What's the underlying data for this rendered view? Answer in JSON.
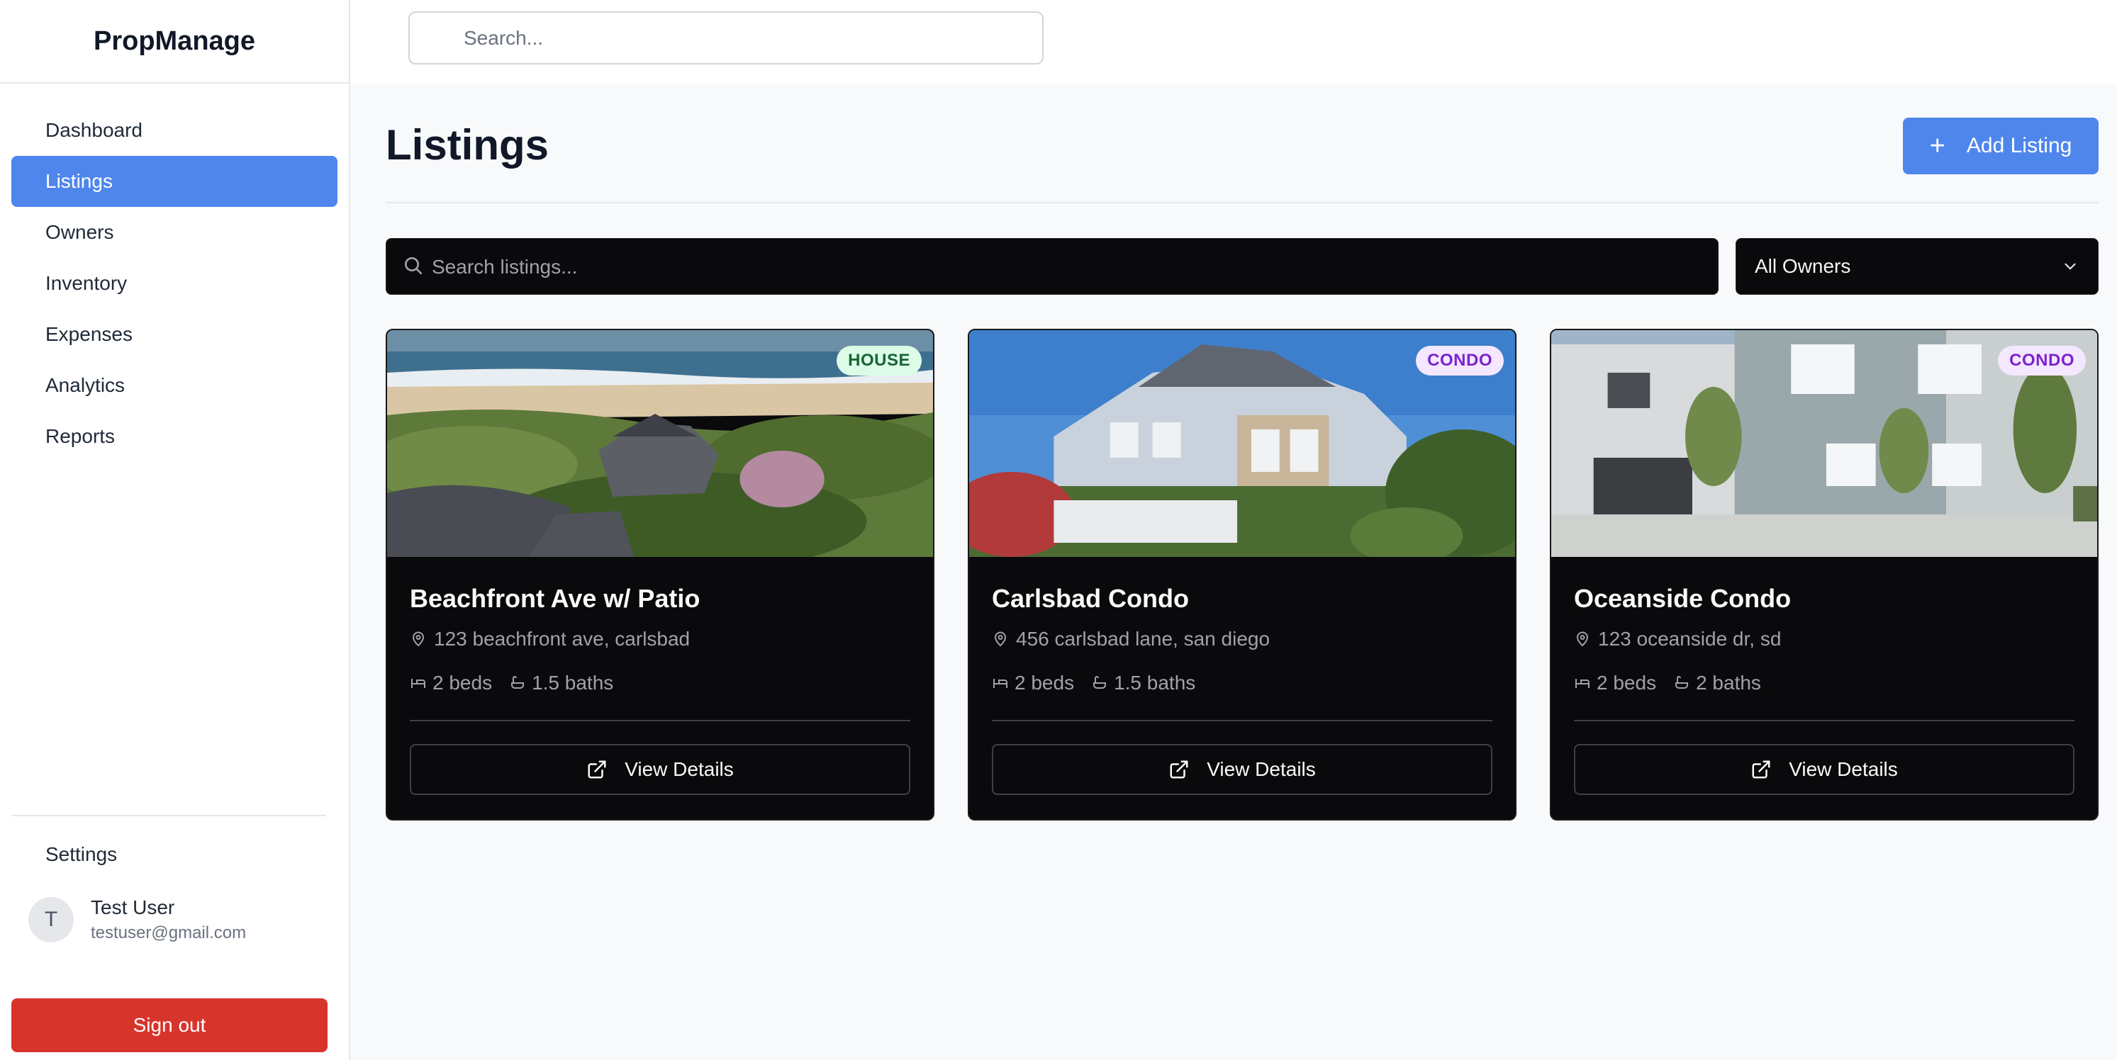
{
  "app": {
    "brand": "PropManage"
  },
  "sidebar": {
    "items": [
      {
        "label": "Dashboard",
        "active": false
      },
      {
        "label": "Listings",
        "active": true
      },
      {
        "label": "Owners",
        "active": false
      },
      {
        "label": "Inventory",
        "active": false
      },
      {
        "label": "Expenses",
        "active": false
      },
      {
        "label": "Analytics",
        "active": false
      },
      {
        "label": "Reports",
        "active": false
      }
    ],
    "settings_label": "Settings",
    "user": {
      "initial": "T",
      "name": "Test User",
      "email": "testuser@gmail.com"
    },
    "signout_label": "Sign out"
  },
  "topbar": {
    "search_placeholder": "Search..."
  },
  "page": {
    "title": "Listings",
    "add_button_label": "Add Listing",
    "filter_search_placeholder": "Search listings...",
    "owner_filter_value": "All Owners"
  },
  "listings": [
    {
      "badge": "HOUSE",
      "title": "Beachfront Ave w/ Patio",
      "address": "123 beachfront ave, carlsbad",
      "beds": "2 beds",
      "baths": "1.5 baths",
      "button_label": "View Details"
    },
    {
      "badge": "CONDO",
      "title": "Carlsbad Condo",
      "address": "456 carlsbad lane, san diego",
      "beds": "2 beds",
      "baths": "1.5 baths",
      "button_label": "View Details"
    },
    {
      "badge": "CONDO",
      "title": "Oceanside Condo",
      "address": "123 oceanside dr, sd",
      "beds": "2 beds",
      "baths": "2 baths",
      "button_label": "View Details"
    }
  ],
  "colors": {
    "accent": "#4f86ec",
    "danger": "#d7342c",
    "card_bg": "#0a0a0c",
    "house_badge_bg": "#dcfce7",
    "condo_badge_bg": "#f3e8ff"
  }
}
